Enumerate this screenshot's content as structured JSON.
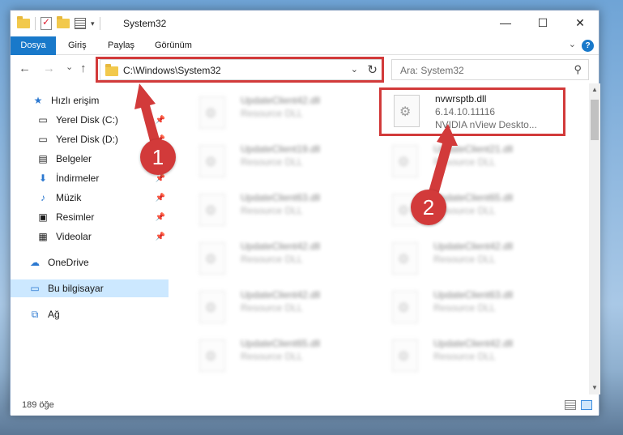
{
  "window": {
    "title": "System32",
    "minimize": "—",
    "maximize": "☐",
    "close": "✕"
  },
  "ribbon": {
    "tabs": [
      "Dosya",
      "Giriş",
      "Paylaş",
      "Görünüm"
    ],
    "help": "?"
  },
  "nav": {
    "back": "←",
    "forward": "→",
    "recent": "⌄",
    "up": "↑",
    "address": "C:\\Windows\\System32",
    "refresh": "↻",
    "search_placeholder": "Ara: System32"
  },
  "sidebar": {
    "items": [
      {
        "label": "Hızlı erişim",
        "icon": "star-icon"
      },
      {
        "label": "Yerel Disk (C:)",
        "icon": "drive-icon",
        "pinned": true
      },
      {
        "label": "Yerel Disk (D:)",
        "icon": "drive-icon",
        "pinned": true
      },
      {
        "label": "Belgeler",
        "icon": "documents-icon",
        "pinned": true
      },
      {
        "label": "İndirmeler",
        "icon": "download-icon",
        "pinned": true
      },
      {
        "label": "Müzik",
        "icon": "music-icon",
        "pinned": true
      },
      {
        "label": "Resimler",
        "icon": "pictures-icon",
        "pinned": true
      },
      {
        "label": "Videolar",
        "icon": "video-icon",
        "pinned": true
      },
      {
        "label": "OneDrive",
        "icon": "cloud-icon"
      },
      {
        "label": "Bu bilgisayar",
        "icon": "computer-icon",
        "selected": true
      },
      {
        "label": "Ağ",
        "icon": "network-icon"
      }
    ]
  },
  "files": {
    "highlighted": {
      "name": "nvwrsptb.dll",
      "version": "6.14.10.11116",
      "description": "NVIDIA nView Deskto..."
    },
    "left_column": [
      {
        "name": "UpdateClient42.dll",
        "type": "Resource DLL"
      },
      {
        "name": "UpdateClient19.dll",
        "type": "Resource DLL"
      },
      {
        "name": "UpdateClient63.dll",
        "type": "Resource DLL"
      },
      {
        "name": "UpdateClient42.dll",
        "type": "Resource DLL"
      },
      {
        "name": "UpdateClient42.dll",
        "type": "Resource DLL"
      },
      {
        "name": "UpdateClient65.dll",
        "type": "Resource DLL"
      }
    ],
    "right_column": [
      {
        "name": "UpdateClient21.dll",
        "type": "Resource DLL"
      },
      {
        "name": "UpdateClient65.dll",
        "type": "Resource DLL"
      },
      {
        "name": "UpdateClient42.dll",
        "type": "Resource DLL"
      },
      {
        "name": "UpdateClient63.dll",
        "type": "Resource DLL"
      },
      {
        "name": "UpdateClient42.dll",
        "type": "Resource DLL"
      }
    ]
  },
  "status": {
    "count": "189 öğe"
  },
  "annotations": {
    "step1": "1",
    "step2": "2",
    "color": "#d23a3a"
  }
}
